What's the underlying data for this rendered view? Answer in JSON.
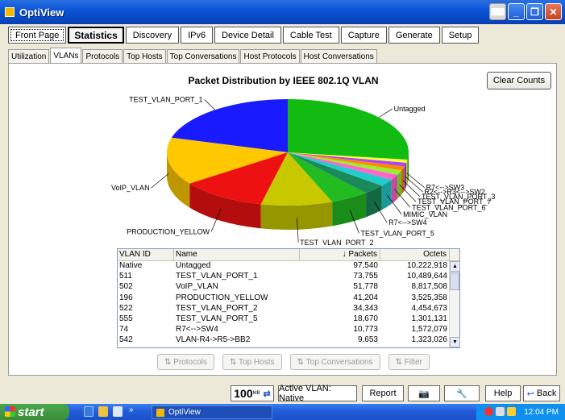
{
  "window": {
    "title": "OptiView"
  },
  "main_tabs": [
    {
      "label": "Front Page"
    },
    {
      "label": "Statistics"
    },
    {
      "label": "Discovery"
    },
    {
      "label": "IPv6"
    },
    {
      "label": "Device Detail"
    },
    {
      "label": "Cable Test"
    },
    {
      "label": "Capture"
    },
    {
      "label": "Generate"
    },
    {
      "label": "Setup"
    }
  ],
  "sub_tabs": [
    {
      "label": "Utilization"
    },
    {
      "label": "VLANs"
    },
    {
      "label": "Protocols"
    },
    {
      "label": "Top Hosts"
    },
    {
      "label": "Top Conversations"
    },
    {
      "label": "Host Protocols"
    },
    {
      "label": "Host Conversations"
    }
  ],
  "clear_counts_label": "Clear Counts",
  "chart_data": {
    "type": "pie",
    "title": "Packet Distribution by IEEE 802.1Q VLAN",
    "slices": [
      {
        "label": "TEST_VLAN_PORT_1",
        "value": 73755,
        "color": "#1a1aff"
      },
      {
        "label": "VoIP_VLAN",
        "value": 51778,
        "color": "#ffc800"
      },
      {
        "label": "PRODUCTION_YELLOW",
        "value": 41204,
        "color": "#ee1111"
      },
      {
        "label": "TEST_VLAN_PORT_2",
        "value": 34343,
        "color": "#c8c800"
      },
      {
        "label": "TEST_VLAN_PORT_5",
        "value": 18670,
        "color": "#22bb22"
      },
      {
        "label": "R7<-->SW4",
        "value": 10773,
        "color": "#1a8a5a"
      },
      {
        "label": "MIMIC_VLAN",
        "value": 8000,
        "color": "#22cccc"
      },
      {
        "label": "TEST_VLAN_PORT_6",
        "value": 6000,
        "color": "#ff66cc"
      },
      {
        "label": "TEST_VLAN_PORT_7",
        "value": 5000,
        "color": "#99ee33"
      },
      {
        "label": "TEST_VLAN_PORT_3",
        "value": 4500,
        "color": "#ff8800"
      },
      {
        "label": "R2<-->R3<-->SW2",
        "value": 4000,
        "color": "#aa44ff"
      },
      {
        "label": "R7<-->SW3",
        "value": 3500,
        "color": "#ffff33"
      },
      {
        "label": "Untagged",
        "value": 97540,
        "color": "#11bb11"
      }
    ],
    "legend": "none"
  },
  "table": {
    "headers": [
      "VLAN ID",
      "Name",
      "↓ Packets",
      "Octets"
    ],
    "rows": [
      [
        "Native",
        "Untagged",
        "97,540",
        "10,222,918"
      ],
      [
        "511",
        "TEST_VLAN_PORT_1",
        "73,755",
        "10,489,644"
      ],
      [
        "502",
        "VoIP_VLAN",
        "51,778",
        "8,817,508"
      ],
      [
        "196",
        "PRODUCTION_YELLOW",
        "41,204",
        "3,525,358"
      ],
      [
        "522",
        "TEST_VLAN_PORT_2",
        "34,343",
        "4,454,673"
      ],
      [
        "555",
        "TEST_VLAN_PORT_5",
        "18,670",
        "1,301,131"
      ],
      [
        "74",
        "R7<-->SW4",
        "10,773",
        "1,572,079"
      ],
      [
        "542",
        "VLAN-R4->R5->BB2",
        "9,653",
        "1,323,026"
      ]
    ]
  },
  "panel_buttons": [
    "Protocols",
    "Top Hosts",
    "Top Conversations",
    "Filter"
  ],
  "status": {
    "speed": "100",
    "speed_unit": "MB",
    "active_vlan": "Active VLAN: Native",
    "report": "Report",
    "help": "Help",
    "back": "Back"
  },
  "taskbar": {
    "start": "start",
    "task": "OptiView",
    "clock": "12:04 PM"
  }
}
